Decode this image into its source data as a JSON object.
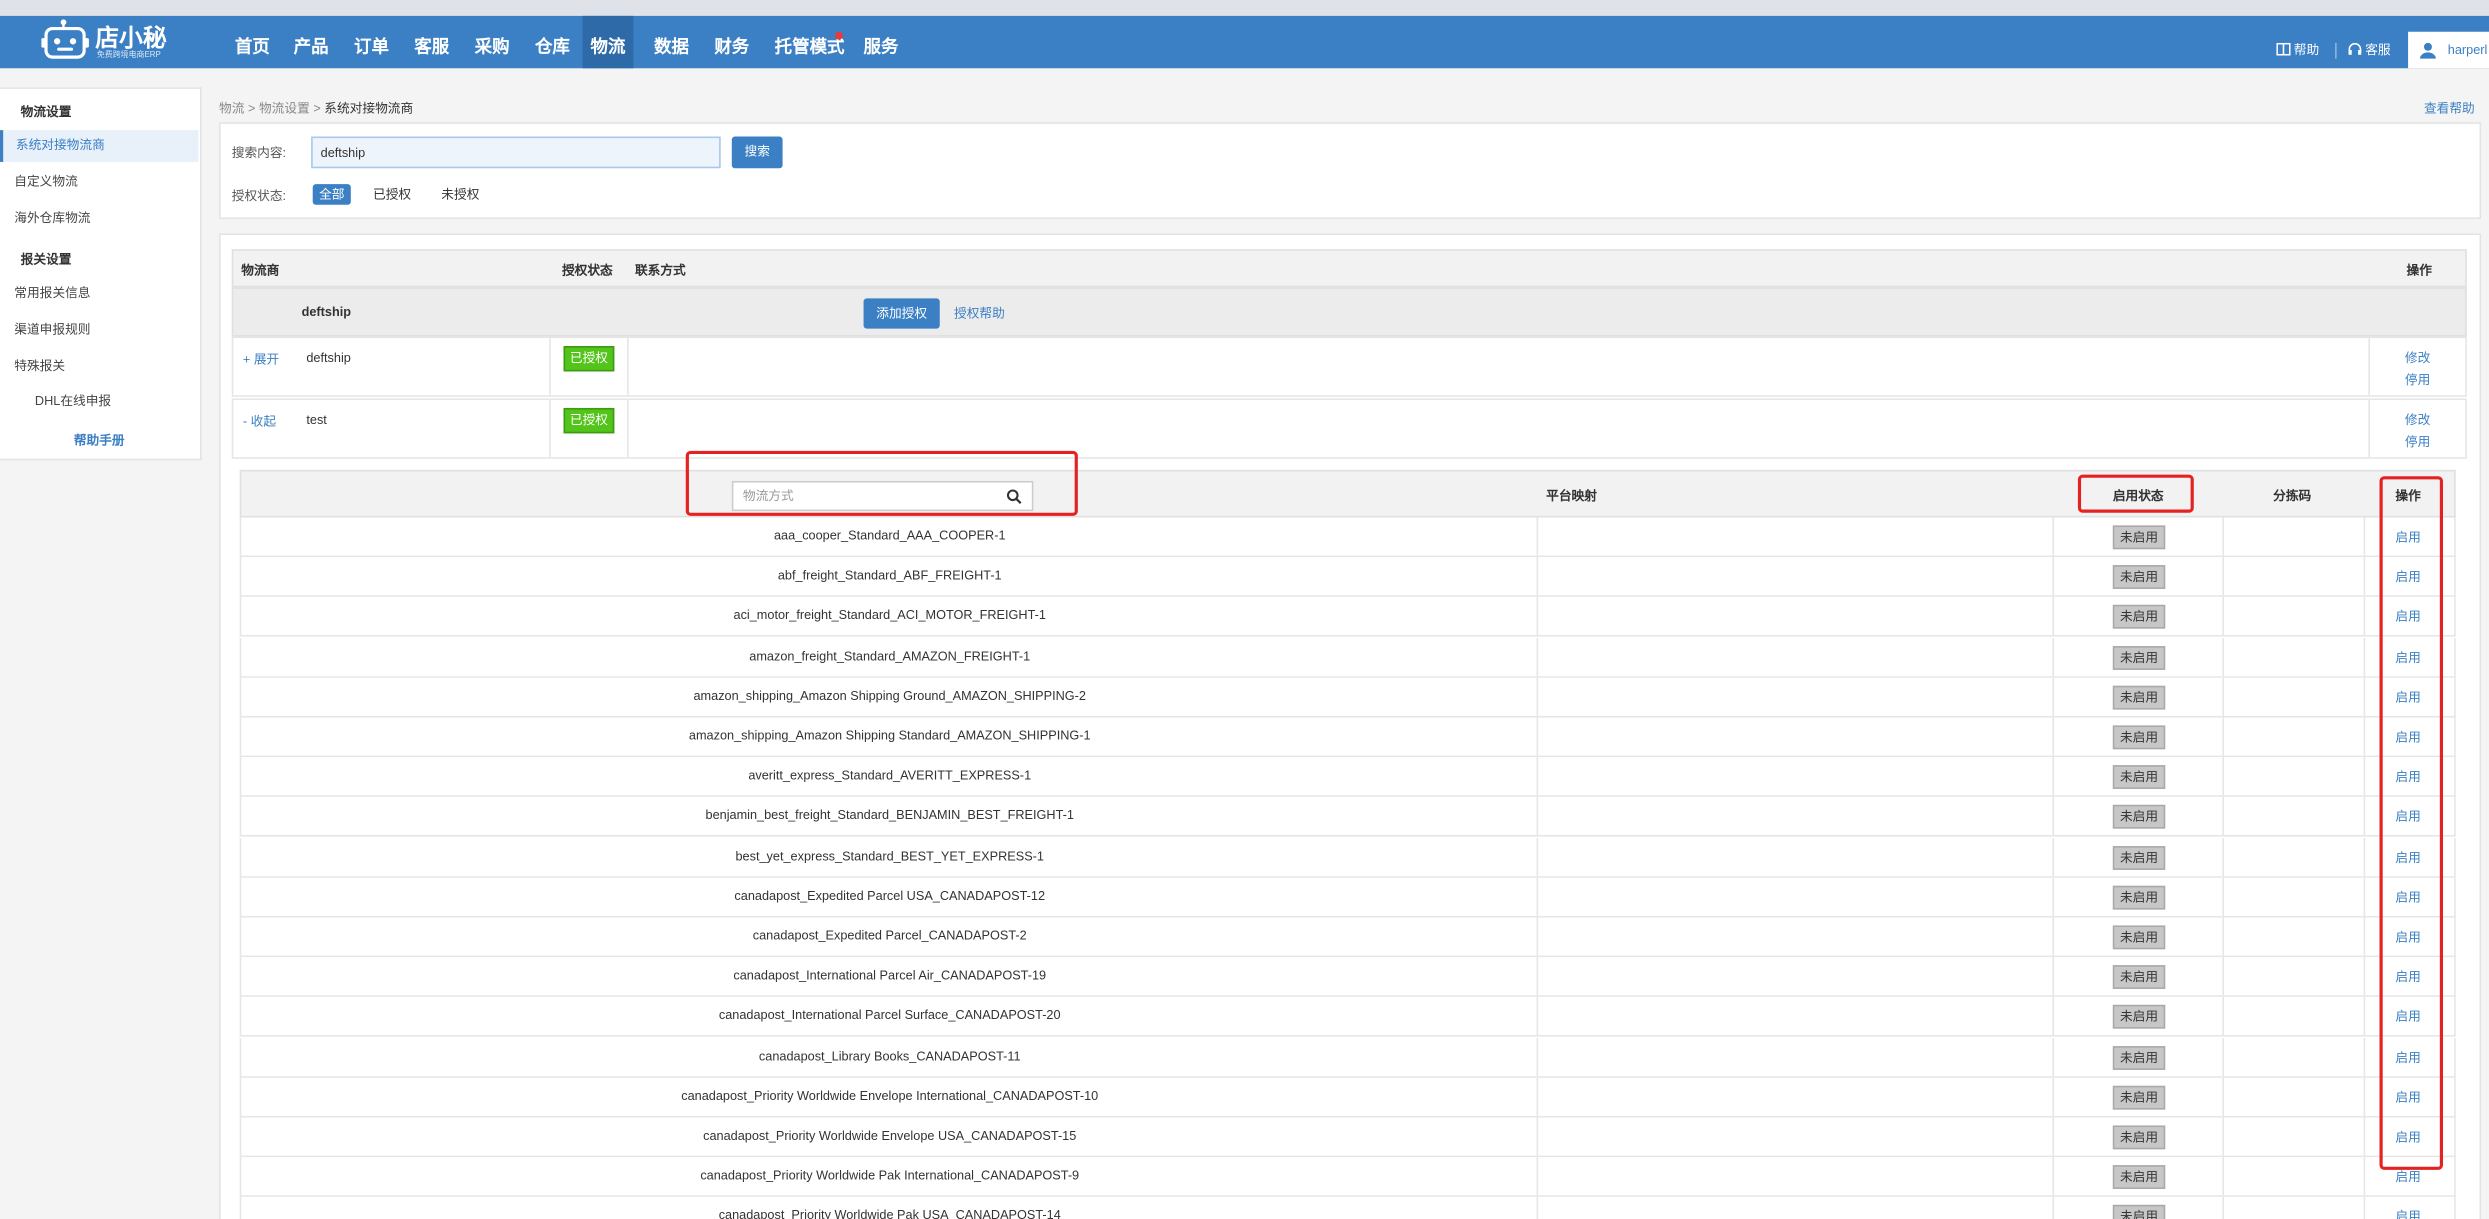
{
  "app": {
    "logo_title": "店小秘",
    "logo_subtitle": "免费跨境电商ERP"
  },
  "nav": {
    "items": [
      {
        "label": "首页"
      },
      {
        "label": "产品"
      },
      {
        "label": "订单"
      },
      {
        "label": "客服"
      },
      {
        "label": "采购"
      },
      {
        "label": "仓库"
      },
      {
        "label": "物流",
        "active": true
      },
      {
        "label": "数据"
      },
      {
        "label": "财务"
      },
      {
        "label": "托管模式",
        "has_dot": true
      },
      {
        "label": "服务"
      }
    ],
    "help_label": "帮助",
    "service_label": "客服",
    "user_name": "harperl"
  },
  "sidebar": {
    "section1_title": "物流设置",
    "section1_items": [
      {
        "label": "系统对接物流商",
        "active": true
      },
      {
        "label": "自定义物流"
      },
      {
        "label": "海外仓库物流"
      }
    ],
    "section2_title": "报关设置",
    "section2_items": [
      {
        "label": "常用报关信息"
      },
      {
        "label": "渠道申报规则"
      },
      {
        "label": "特殊报关"
      },
      {
        "label": "DHL在线申报"
      }
    ],
    "help_manual": "帮助手册"
  },
  "breadcrumb": {
    "level1": "物流",
    "level2": "物流设置",
    "current": "系统对接物流商",
    "separator": ">"
  },
  "view_help": "查看帮助",
  "search": {
    "label": "搜索内容:",
    "value": "deftship",
    "button": "搜索",
    "status_label": "授权状态:",
    "status_options": [
      {
        "label": "全部",
        "selected": true
      },
      {
        "label": "已授权"
      },
      {
        "label": "未授权"
      }
    ]
  },
  "table": {
    "headers": {
      "carrier": "物流商",
      "auth_status": "授权状态",
      "contact": "联系方式",
      "operation": "操作"
    },
    "group": {
      "name": "deftship",
      "add_auth_button": "添加授权",
      "auth_help_link": "授权帮助"
    },
    "carrier_rows": [
      {
        "toggle": "+ 展开",
        "name": "deftship",
        "status": "已授权",
        "edit": "修改",
        "disable": "停用"
      },
      {
        "toggle": "- 收起",
        "name": "test",
        "status": "已授权",
        "edit": "修改",
        "disable": "停用"
      }
    ]
  },
  "methods": {
    "search_placeholder": "物流方式",
    "headers": {
      "platform_mapping": "平台映射",
      "enable_status": "启用状态",
      "sort_code": "分拣码",
      "operation": "操作"
    },
    "status_text": "未启用",
    "enable_text": "启用",
    "rows": [
      "aaa_cooper_Standard_AAA_COOPER-1",
      "abf_freight_Standard_ABF_FREIGHT-1",
      "aci_motor_freight_Standard_ACI_MOTOR_FREIGHT-1",
      "amazon_freight_Standard_AMAZON_FREIGHT-1",
      "amazon_shipping_Amazon Shipping Ground_AMAZON_SHIPPING-2",
      "amazon_shipping_Amazon Shipping Standard_AMAZON_SHIPPING-1",
      "averitt_express_Standard_AVERITT_EXPRESS-1",
      "benjamin_best_freight_Standard_BENJAMIN_BEST_FREIGHT-1",
      "best_yet_express_Standard_BEST_YET_EXPRESS-1",
      "canadapost_Expedited Parcel USA_CANADAPOST-12",
      "canadapost_Expedited Parcel_CANADAPOST-2",
      "canadapost_International Parcel Air_CANADAPOST-19",
      "canadapost_International Parcel Surface_CANADAPOST-20",
      "canadapost_Library Books_CANADAPOST-11",
      "canadapost_Priority Worldwide Envelope International_CANADAPOST-10",
      "canadapost_Priority Worldwide Envelope USA_CANADAPOST-15",
      "canadapost_Priority Worldwide Pak International_CANADAPOST-9",
      "canadapost_Priority Worldwide Pak USA_CANADAPOST-14"
    ]
  },
  "colors": {
    "brand": "#3b7fc4",
    "authorized_badge": "#52c41a",
    "highlight": "#e52222"
  }
}
